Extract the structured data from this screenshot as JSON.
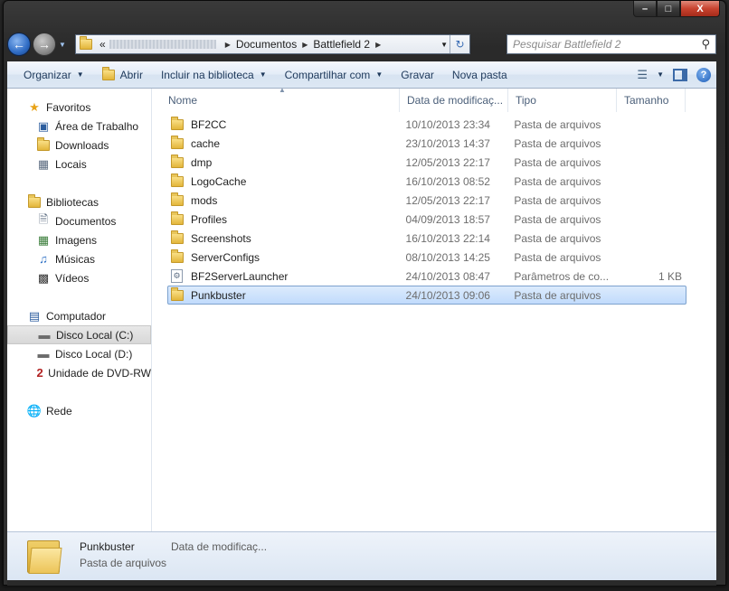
{
  "window": {
    "caption_min": "–",
    "caption_max": "□",
    "caption_close": "X"
  },
  "navbar": {
    "back_icon": "back-arrow-icon",
    "forward_icon": "forward-arrow-icon",
    "address_prefix": "«",
    "breadcrumbs": [
      "Documentos",
      "Battlefield 2"
    ],
    "search_placeholder": "Pesquisar Battlefield 2"
  },
  "toolbar": {
    "organize": "Organizar",
    "open": "Abrir",
    "include_library": "Incluir na biblioteca",
    "share_with": "Compartilhar com",
    "burn": "Gravar",
    "new_folder": "Nova pasta",
    "help": "?"
  },
  "sidebar": {
    "favorites": {
      "label": "Favoritos",
      "items": [
        "Área de Trabalho",
        "Downloads",
        "Locais"
      ]
    },
    "libraries": {
      "label": "Bibliotecas",
      "items": [
        "Documentos",
        "Imagens",
        "Músicas",
        "Vídeos"
      ]
    },
    "computer": {
      "label": "Computador",
      "items": [
        "Disco Local (C:)",
        "Disco Local (D:)",
        "Unidade de DVD-RW"
      ]
    },
    "network": {
      "label": "Rede"
    }
  },
  "columns": {
    "name": "Nome",
    "date": "Data de modificaç...",
    "type": "Tipo",
    "size": "Tamanho"
  },
  "files": [
    {
      "name": "BF2CC",
      "date": "10/10/2013 23:34",
      "type": "Pasta de arquivos",
      "size": "",
      "kind": "folder"
    },
    {
      "name": "cache",
      "date": "23/10/2013 14:37",
      "type": "Pasta de arquivos",
      "size": "",
      "kind": "folder"
    },
    {
      "name": "dmp",
      "date": "12/05/2013 22:17",
      "type": "Pasta de arquivos",
      "size": "",
      "kind": "folder"
    },
    {
      "name": "LogoCache",
      "date": "16/10/2013 08:52",
      "type": "Pasta de arquivos",
      "size": "",
      "kind": "folder"
    },
    {
      "name": "mods",
      "date": "12/05/2013 22:17",
      "type": "Pasta de arquivos",
      "size": "",
      "kind": "folder"
    },
    {
      "name": "Profiles",
      "date": "04/09/2013 18:57",
      "type": "Pasta de arquivos",
      "size": "",
      "kind": "folder"
    },
    {
      "name": "Screenshots",
      "date": "16/10/2013 22:14",
      "type": "Pasta de arquivos",
      "size": "",
      "kind": "folder"
    },
    {
      "name": "ServerConfigs",
      "date": "08/10/2013 14:25",
      "type": "Pasta de arquivos",
      "size": "",
      "kind": "folder"
    },
    {
      "name": "BF2ServerLauncher",
      "date": "24/10/2013 08:47",
      "type": "Parâmetros de co...",
      "size": "1 KB",
      "kind": "config"
    },
    {
      "name": "Punkbuster",
      "date": "24/10/2013 09:06",
      "type": "Pasta de arquivos",
      "size": "",
      "kind": "folder",
      "selected": true
    }
  ],
  "details": {
    "name": "Punkbuster",
    "type": "Pasta de arquivos",
    "date_label": "Data de modificaç..."
  },
  "colors": {
    "selection": "#c1dbfc",
    "toolbar_text": "#1e395b",
    "folder": "#e3b63a"
  }
}
